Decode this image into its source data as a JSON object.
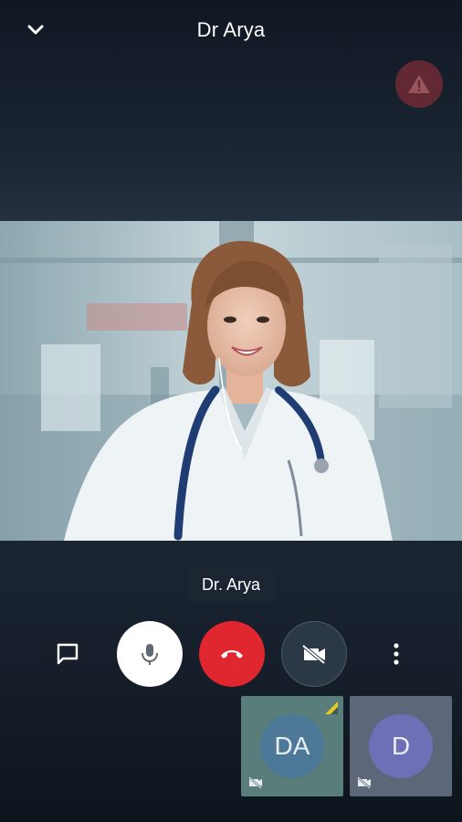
{
  "header": {
    "title": "Dr Arya",
    "back_icon": "chevron-down-icon",
    "warning_icon": "warning-icon"
  },
  "video": {
    "caption": "Dr. Arya"
  },
  "controls": {
    "chat_icon": "chat-icon",
    "mic_icon": "microphone-icon",
    "end_call_icon": "hang-up-icon",
    "camera_icon": "camera-off-icon",
    "more_icon": "more-vertical-icon",
    "colors": {
      "end_call": "#e0262e",
      "mic_bg": "#ffffff",
      "camera_bg": "#2b3947"
    }
  },
  "participants": [
    {
      "initials": "DA",
      "tile_color": "#597d7a",
      "avatar_color": "#4d7898",
      "camera_off": true,
      "signal_indicator": true
    },
    {
      "initials": "D",
      "tile_color": "#5c6879",
      "avatar_color": "#6d70b6",
      "camera_off": true,
      "signal_indicator": false
    }
  ]
}
